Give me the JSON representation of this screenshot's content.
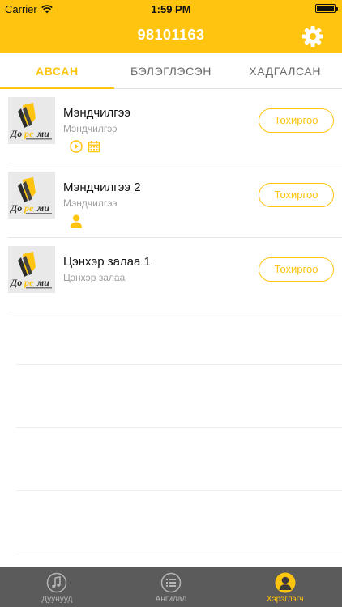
{
  "status_bar": {
    "carrier": "Carrier",
    "time": "1:59 PM"
  },
  "header": {
    "title": "98101163",
    "settings_icon": "gear-icon"
  },
  "tabs": [
    {
      "label": "АВСАН",
      "active": true
    },
    {
      "label": "БЭЛЭГЛЭСЭН",
      "active": false
    },
    {
      "label": "ХАДГАЛСАН",
      "active": false
    }
  ],
  "rows": [
    {
      "title": "Мэндчилгээ",
      "subtitle": "Мэндчилгээ",
      "button": "Тохиргоо",
      "icons": [
        "play-circle-icon",
        "calendar-icon"
      ]
    },
    {
      "title": "Мэндчилгээ 2",
      "subtitle": "Мэндчилгээ",
      "button": "Тохиргоо",
      "icons": [
        "person-icon"
      ]
    },
    {
      "title": "Цэнхэр залаа 1",
      "subtitle": "Цэнхэр залаа",
      "button": "Тохиргоо",
      "icons": []
    }
  ],
  "thumbnail_logo": {
    "part1": "До",
    "part2": "ре",
    "part3": "ми"
  },
  "tab_bar": [
    {
      "label": "Дуунууд",
      "icon": "music-note-icon",
      "active": false
    },
    {
      "label": "Ангилал",
      "icon": "list-icon",
      "active": false
    },
    {
      "label": "Хэрэглэгч",
      "icon": "user-icon",
      "active": true
    }
  ],
  "colors": {
    "accent": "#fec40f",
    "tab_bar_bg": "#5b5b5b",
    "subtitle": "#a0a0a0"
  }
}
